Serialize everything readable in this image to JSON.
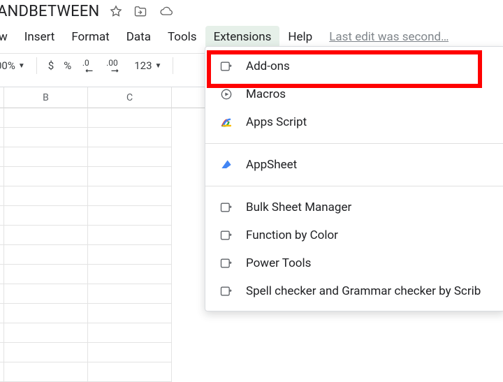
{
  "title": "ANDBETWEEN",
  "menubar": {
    "view_trunc": "w",
    "items": [
      "Insert",
      "Format",
      "Data",
      "Tools",
      "Extensions",
      "Help"
    ]
  },
  "lastEdit": "Last edit was second…",
  "toolbar": {
    "zoom": "00%",
    "currency": "$",
    "percent": "%",
    "decDec": ".0",
    "incDec": ".00",
    "numFormat": "123"
  },
  "columns": [
    "B",
    "C"
  ],
  "extMenu": {
    "addons": "Add-ons",
    "macros": "Macros",
    "appsScript": "Apps Script",
    "appsheet": "AppSheet",
    "bulkSheet": "Bulk Sheet Manager",
    "fnByColor": "Function by Color",
    "powerTools": "Power Tools",
    "spellCheck": "Spell checker and Grammar checker by Scrib"
  }
}
